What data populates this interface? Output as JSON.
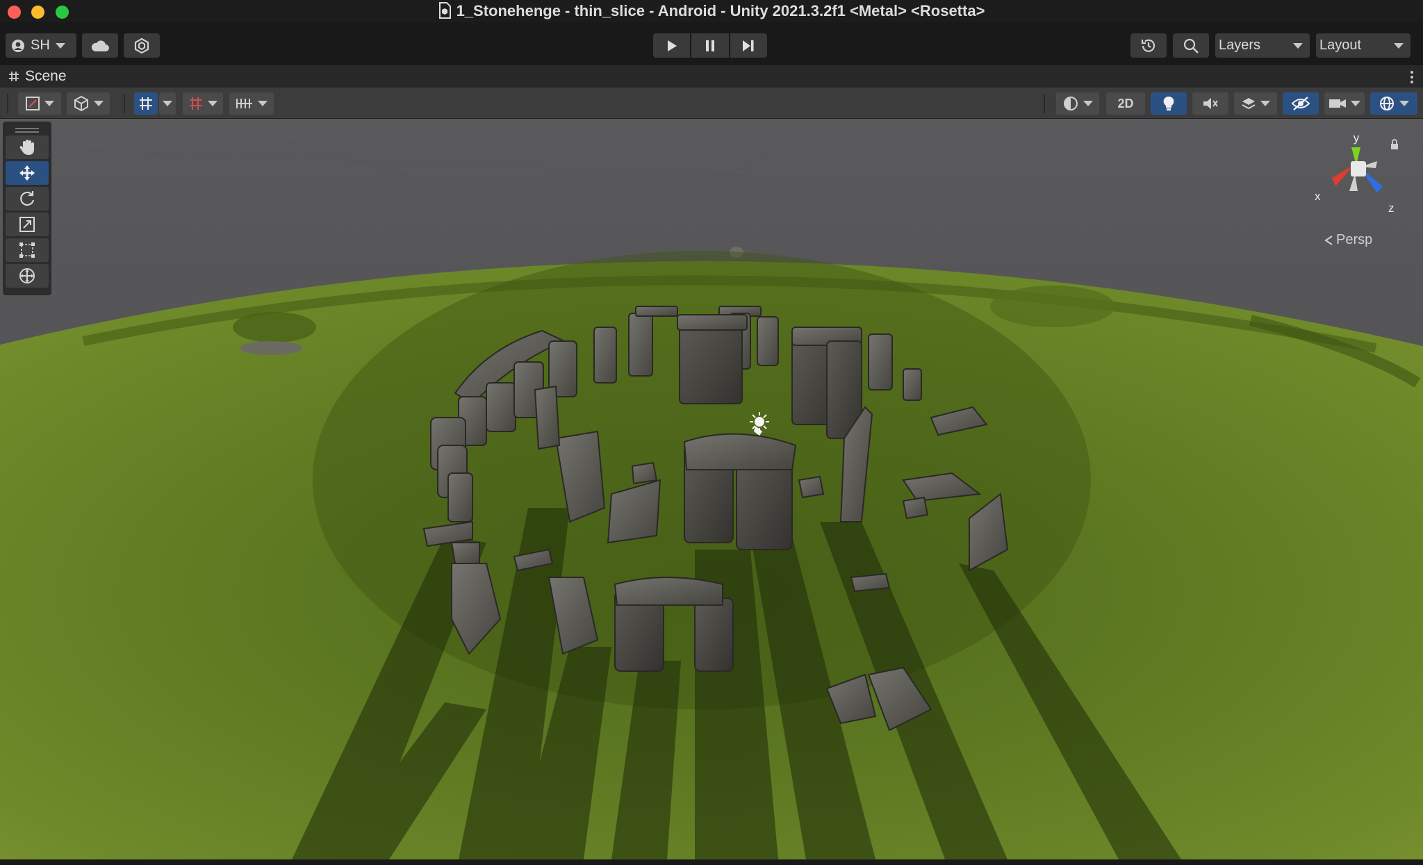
{
  "window": {
    "title": "1_Stonehenge - thin_slice - Android - Unity 2021.3.2f1 <Metal> <Rosetta>"
  },
  "toolbar": {
    "account_label": "SH",
    "play_icons": [
      "play-icon",
      "pause-icon",
      "step-icon"
    ],
    "layers_label": "Layers",
    "layout_label": "Layout"
  },
  "scene_tab": {
    "label": "Scene"
  },
  "scene_toolbar": {
    "mode_2d_label": "2D",
    "active_color": "#2b5183"
  },
  "tools": [
    "view-tool",
    "move-tool",
    "rotate-tool",
    "scale-tool",
    "rect-tool",
    "transform-tool"
  ],
  "active_tool": "move-tool",
  "gizmo": {
    "axis_x": "x",
    "axis_y": "y",
    "axis_z": "z",
    "projection": "Persp",
    "colors": {
      "x": "#e23c2c",
      "y": "#7ed321",
      "z": "#2f6fe0"
    }
  }
}
